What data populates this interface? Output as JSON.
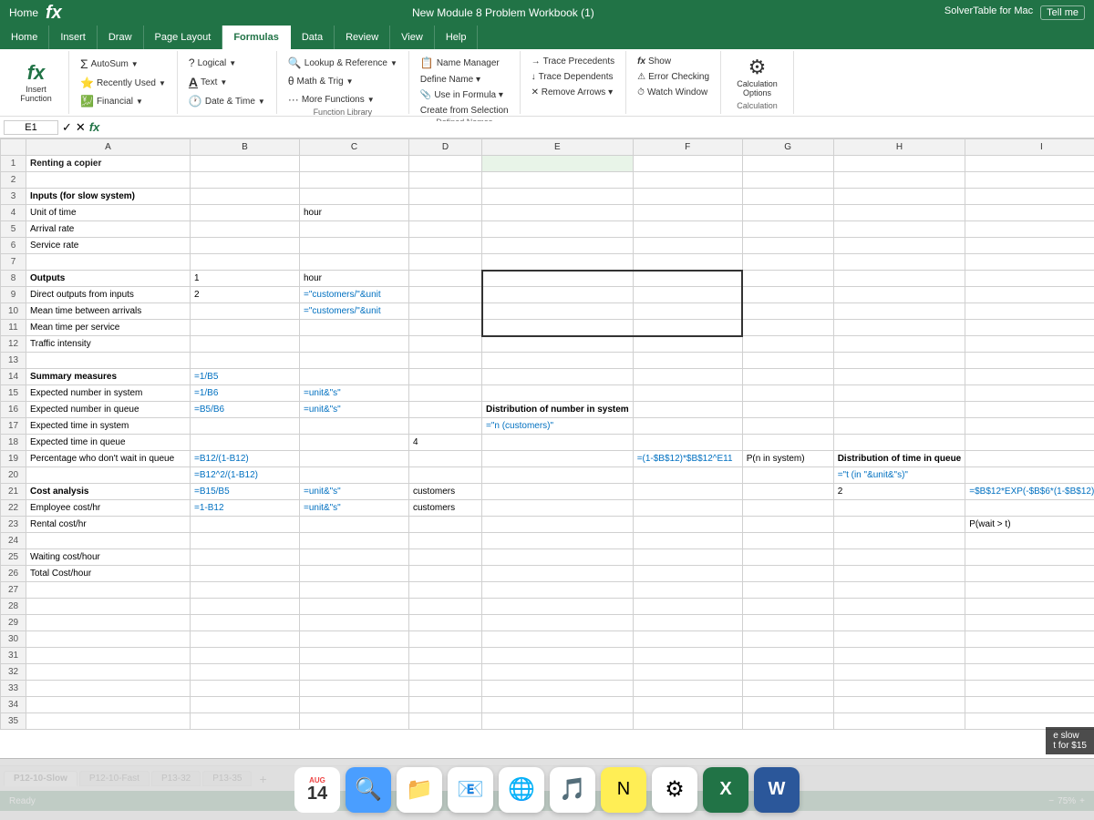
{
  "titleBar": {
    "appName": "fx",
    "fileName": "New Module 8 Problem Workbook (1)",
    "subtitle": "SolverTable for Mac",
    "tellMe": "Tell me"
  },
  "ribbonTabs": [
    {
      "label": "Home",
      "active": false
    },
    {
      "label": "Insert",
      "active": false
    },
    {
      "label": "Draw",
      "active": false
    },
    {
      "label": "Page Layout",
      "active": false
    },
    {
      "label": "Formulas",
      "active": true
    },
    {
      "label": "Data",
      "active": false
    },
    {
      "label": "Review",
      "active": false
    },
    {
      "label": "View",
      "active": false
    },
    {
      "label": "Help",
      "active": false
    }
  ],
  "formulaGroups": [
    {
      "label": "Insert Function",
      "icon": "fx"
    },
    {
      "label": "AutoSum",
      "icon": "Σ"
    },
    {
      "label": "Recently Used",
      "icon": "⭐"
    },
    {
      "label": "Financial",
      "icon": "💰"
    },
    {
      "label": "Logical",
      "icon": "?"
    },
    {
      "label": "Text",
      "icon": "A"
    },
    {
      "label": "Date & Time",
      "icon": "🕐"
    },
    {
      "label": "Lookup & Reference",
      "icon": "🔍"
    },
    {
      "label": "Math & Trig",
      "icon": "θ"
    },
    {
      "label": "More Functions",
      "icon": "···"
    },
    {
      "label": "Name Manager",
      "icon": "📋"
    },
    {
      "label": "Define Name",
      "icon": ""
    },
    {
      "label": "Use in Formula",
      "icon": ""
    },
    {
      "label": "Create from Selection",
      "icon": ""
    },
    {
      "label": "Trace Precedents",
      "icon": ""
    },
    {
      "label": "Trace Dependents",
      "icon": ""
    },
    {
      "label": "Remove Arrows",
      "icon": ""
    },
    {
      "label": "Show Formulas",
      "icon": "fx"
    },
    {
      "label": "Error Checking",
      "icon": "⚠"
    },
    {
      "label": "Watch Window",
      "icon": "⏱"
    },
    {
      "label": "Calculation Options",
      "icon": "⚙"
    }
  ],
  "formulaBar": {
    "cellRef": "E1",
    "formula": "fx"
  },
  "spreadsheet": {
    "columns": [
      "A",
      "B",
      "C",
      "D",
      "E",
      "F",
      "G",
      "H",
      "I"
    ],
    "rows": [
      {
        "num": 1,
        "cells": [
          "Renting a copier",
          "",
          "",
          "",
          "",
          "",
          "",
          "",
          ""
        ]
      },
      {
        "num": 2,
        "cells": [
          "",
          "",
          "",
          "",
          "",
          "",
          "",
          "",
          ""
        ]
      },
      {
        "num": 3,
        "cells": [
          "Inputs (for slow system)",
          "",
          "",
          "",
          "",
          "",
          "",
          "",
          ""
        ]
      },
      {
        "num": 4,
        "cells": [
          "Unit of time",
          "",
          "hour",
          "",
          "",
          "",
          "",
          "",
          ""
        ]
      },
      {
        "num": 5,
        "cells": [
          "Arrival rate",
          "",
          "",
          "",
          "",
          "",
          "",
          "",
          ""
        ]
      },
      {
        "num": 6,
        "cells": [
          "Service rate",
          "",
          "",
          "",
          "",
          "",
          "",
          "",
          ""
        ]
      },
      {
        "num": 7,
        "cells": [
          "",
          "",
          "",
          "",
          "",
          "",
          "",
          "",
          ""
        ]
      },
      {
        "num": 8,
        "cells": [
          "Outputs",
          "1",
          "hour",
          "",
          "",
          "",
          "",
          "",
          ""
        ]
      },
      {
        "num": 9,
        "cells": [
          "Direct outputs from inputs",
          "2",
          "=\"customers/\"&unit",
          "",
          "",
          "",
          "",
          "",
          ""
        ]
      },
      {
        "num": 10,
        "cells": [
          "Mean time between arrivals",
          "",
          "=\"customers/\"&unit",
          "",
          "",
          "",
          "",
          "",
          ""
        ]
      },
      {
        "num": 11,
        "cells": [
          "Mean time per service",
          "",
          "",
          "",
          "",
          "",
          "",
          "",
          ""
        ]
      },
      {
        "num": 12,
        "cells": [
          "Traffic intensity",
          "",
          "",
          "",
          "",
          "",
          "",
          "",
          ""
        ]
      },
      {
        "num": 13,
        "cells": [
          "",
          "",
          "",
          "",
          "",
          "",
          "",
          "",
          ""
        ]
      },
      {
        "num": 14,
        "cells": [
          "Summary measures",
          "=1/B5",
          "",
          "",
          "",
          "",
          "",
          "",
          ""
        ]
      },
      {
        "num": 15,
        "cells": [
          "Expected number in system",
          "=1/B6",
          "=unit&\"s\"",
          "",
          "",
          "",
          "",
          "",
          ""
        ]
      },
      {
        "num": 16,
        "cells": [
          "Expected number in queue",
          "=B5/B6",
          "=unit&\"s\"",
          "",
          "Distribution of number in system",
          "",
          "",
          "",
          ""
        ]
      },
      {
        "num": 17,
        "cells": [
          "Expected time in system",
          "",
          "",
          "",
          "=\"n (customers)\"",
          "",
          "",
          "",
          ""
        ]
      },
      {
        "num": 18,
        "cells": [
          "Expected time in queue",
          "",
          "",
          "4",
          "",
          "",
          "",
          "",
          ""
        ]
      },
      {
        "num": 19,
        "cells": [
          "Percentage who don't wait in queue",
          "=B12/(1-B12)",
          "",
          "",
          "",
          "=(1-$B$12)*$B$12^E11",
          "P(n in system)",
          "Distribution of time in queue",
          ""
        ]
      },
      {
        "num": 20,
        "cells": [
          "",
          "=B12^2/(1-B12)",
          "",
          "",
          "",
          "",
          "",
          "=\"t (in \"&unit&\"s)\"",
          ""
        ]
      },
      {
        "num": 21,
        "cells": [
          "Cost analysis",
          "=B15/B5",
          "=unit&\"s\"",
          "customers",
          "",
          "",
          "",
          "2",
          "=$B$12*EXP(-$B$6*(1-$B$12)*t21)"
        ]
      },
      {
        "num": 22,
        "cells": [
          "Employee cost/hr",
          "=1-B12",
          "=unit&\"s\"",
          "customers",
          "",
          "",
          "",
          "",
          ""
        ]
      },
      {
        "num": 23,
        "cells": [
          "Rental cost/hr",
          "",
          "",
          "",
          "",
          "",
          "",
          "",
          "P(wait > t)"
        ]
      },
      {
        "num": 24,
        "cells": [
          "",
          "",
          "",
          "",
          "",
          "",
          "",
          "",
          ""
        ]
      },
      {
        "num": 25,
        "cells": [
          "Waiting cost/hour",
          "",
          "",
          "",
          "",
          "",
          "",
          "",
          ""
        ]
      },
      {
        "num": 26,
        "cells": [
          "Total Cost/hour",
          "",
          "",
          "",
          "",
          "",
          "",
          "",
          ""
        ]
      },
      {
        "num": 27,
        "cells": [
          "",
          "",
          "",
          "",
          "",
          "",
          "",
          "",
          ""
        ]
      },
      {
        "num": 28,
        "cells": [
          "",
          "",
          "",
          "",
          "",
          "",
          "",
          "",
          ""
        ]
      },
      {
        "num": 29,
        "cells": [
          "",
          "",
          "",
          "",
          "",
          "",
          "",
          "",
          ""
        ]
      },
      {
        "num": 30,
        "cells": [
          "",
          "",
          "",
          "",
          "",
          "",
          "",
          "",
          ""
        ]
      },
      {
        "num": 31,
        "cells": [
          "",
          "",
          "",
          "",
          "",
          "",
          "",
          "",
          ""
        ]
      },
      {
        "num": 32,
        "cells": [
          "",
          "",
          "",
          "",
          "",
          "",
          "",
          "",
          ""
        ]
      },
      {
        "num": 33,
        "cells": [
          "",
          "",
          "",
          "",
          "",
          "",
          "",
          "",
          ""
        ]
      },
      {
        "num": 34,
        "cells": [
          "",
          "",
          "",
          "",
          "",
          "",
          "",
          "",
          ""
        ]
      },
      {
        "num": 35,
        "cells": [
          "",
          "",
          "",
          "",
          "",
          "",
          "",
          "",
          ""
        ]
      }
    ]
  },
  "sheetTabs": [
    {
      "label": "P12-10-Slow",
      "active": true
    },
    {
      "label": "P12-10-Fast",
      "active": false
    },
    {
      "label": "P13-32",
      "active": false
    },
    {
      "label": "P13-35",
      "active": false
    }
  ],
  "statusBar": {
    "status": "Ready",
    "zoom": "75%",
    "zoomValue": 75
  },
  "dock": {
    "date": "14",
    "month": "AUG",
    "items": [
      "🔍",
      "📁",
      "📧",
      "🌐",
      "🎵",
      "📝",
      "⚙️",
      "🎯"
    ]
  },
  "bottomOverlay": {
    "line1": "e slow",
    "line2": "t for $15"
  }
}
